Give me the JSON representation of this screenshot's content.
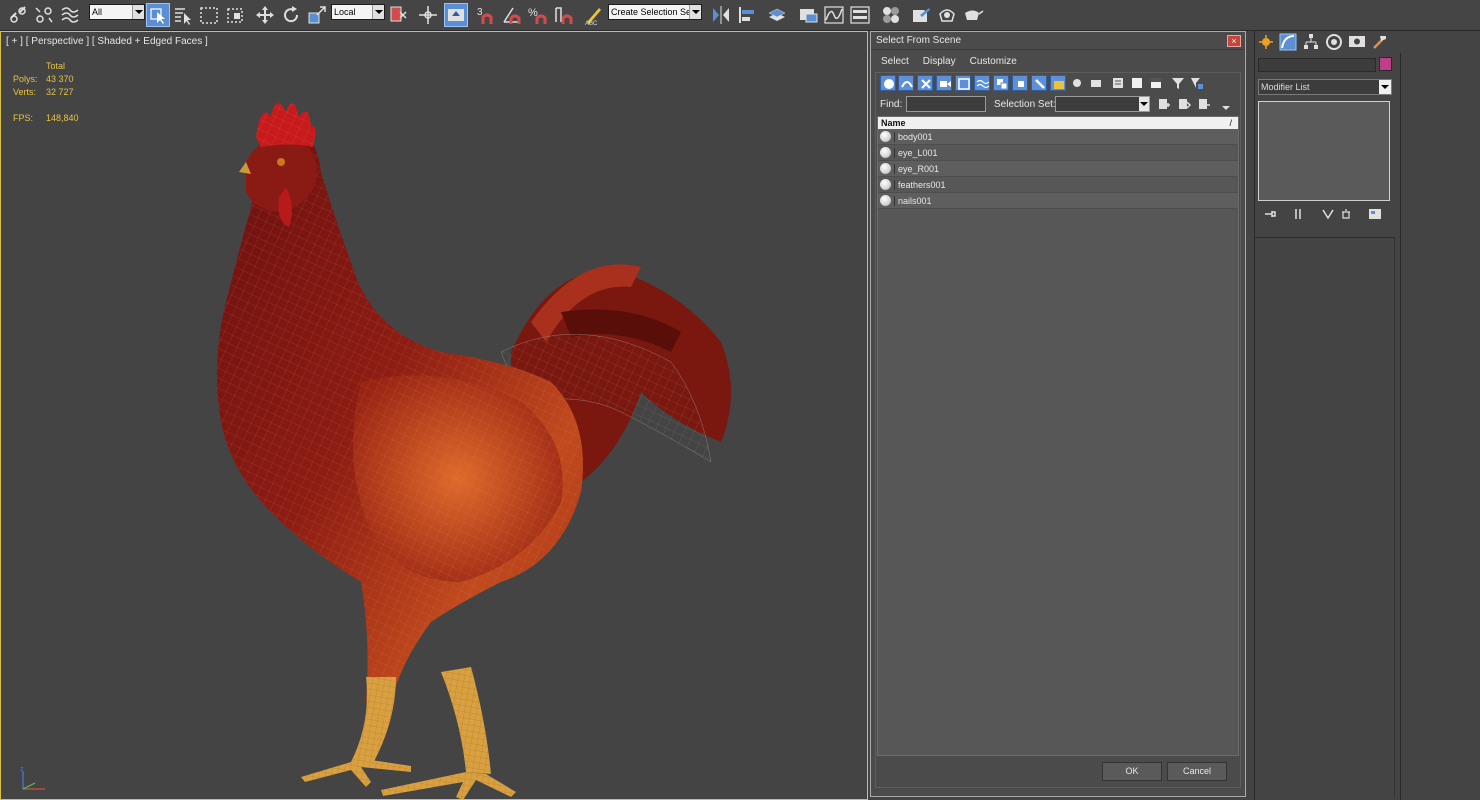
{
  "toolbar": {
    "selection_filter": "All",
    "reference_coordinate_system": "Local",
    "named_selection_set": "Create Selection Se",
    "snap_labels": {
      "snap": "3",
      "angle_snap": "∠",
      "percent_snap": "%"
    }
  },
  "viewport": {
    "label": "[ + ] [ Perspective ] [ Shaded + Edged Faces ]",
    "stats": {
      "header": "Total",
      "polys_label": "Polys:",
      "polys_value": "43 370",
      "verts_label": "Verts:",
      "verts_value": "32 727",
      "fps_label": "FPS:",
      "fps_value": "148,840"
    }
  },
  "dialog": {
    "title": "Select From Scene",
    "close": "×",
    "menu": [
      "Select",
      "Display",
      "Customize"
    ],
    "find_label": "Find:",
    "find_value": "",
    "selection_set_label": "Selection Set:",
    "selection_set_value": "",
    "column_name": "Name",
    "sort_indicator": "/",
    "objects": [
      "body001",
      "eye_L001",
      "eye_R001",
      "feathers001",
      "nails001"
    ],
    "ok_label": "OK",
    "cancel_label": "Cancel"
  },
  "command_panel": {
    "object_name": "",
    "object_color": "#c03d8a",
    "modifier_list": "Modifier List",
    "tab_icons": [
      "create-icon",
      "modify-icon",
      "hierarchy-icon",
      "motion-icon",
      "display-icon",
      "utilities-icon"
    ]
  },
  "colors": {
    "viewport_bg": "#444444",
    "active_border": "#d8c04a",
    "stats_text": "#e8c43c",
    "button_active": "#5b8fd4"
  }
}
